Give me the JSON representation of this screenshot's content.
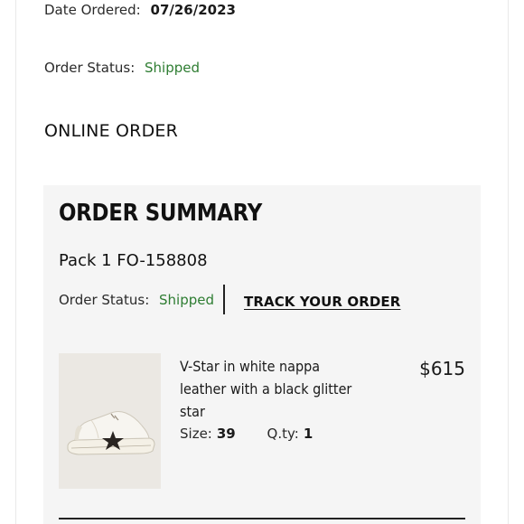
{
  "order": {
    "date_label": "Date Ordered:",
    "date_value": "07/26/2023",
    "status_label": "Order Status:",
    "status_value": "Shipped",
    "channel": "ONLINE ORDER"
  },
  "summary": {
    "title": "ORDER SUMMARY",
    "pack": "Pack 1 FO-158808",
    "status_label": "Order Status:",
    "status_value": "Shipped",
    "track_label": "TRACK YOUR ORDER",
    "item": {
      "name": "V-Star in white nappa leather with a black glitter star",
      "price": "$615",
      "size_label": "Size:",
      "size_value": "39",
      "qty_label": "Q.ty:",
      "qty_value": "1",
      "image_icon": "sneaker-image"
    }
  },
  "colors": {
    "status_green": "#2e7d32",
    "summary_bg": "#f5f5f5"
  }
}
